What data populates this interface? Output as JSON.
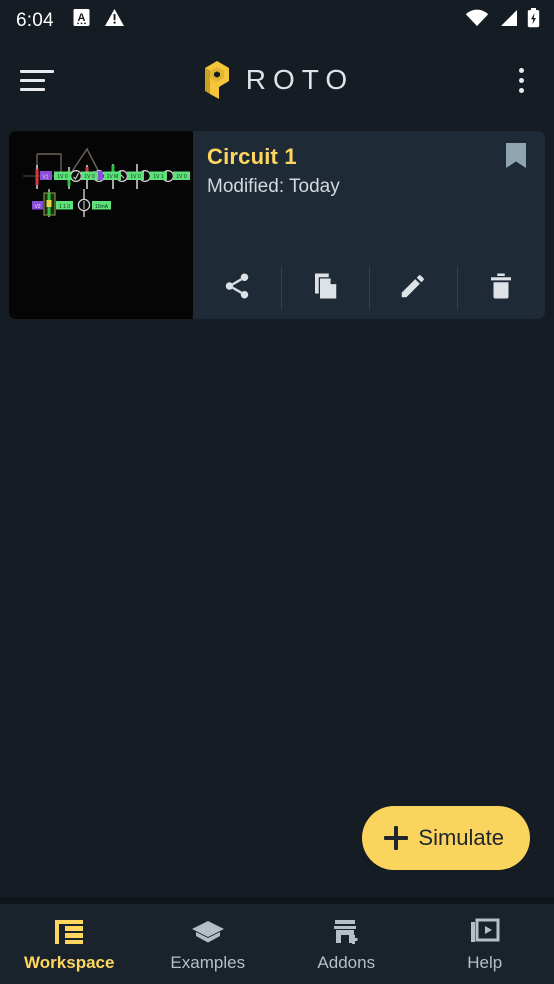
{
  "status_bar": {
    "time": "6:04",
    "left_icons": [
      "alphabet-mode-icon",
      "warning-triangle-icon"
    ],
    "right_icons": [
      "wifi-icon",
      "cellular-signal-icon",
      "battery-charging-icon"
    ]
  },
  "app_bar": {
    "menu_icon": "hamburger-menu-icon",
    "logo_icon": "proto-p-logo-icon",
    "title": "ROTO",
    "overflow_icon": "overflow-menu-icon",
    "logo_color": "#f5c63c",
    "title_color": "#dfe3e8"
  },
  "circuit_card": {
    "title": "Circuit 1",
    "subtitle": "Modified: Today",
    "bookmark_icon": "bookmark-icon",
    "thumbnail_name": "circuit-schematic-thumbnail",
    "title_color": "#ffd75e",
    "card_color": "#1e2a36",
    "actions": [
      {
        "name": "share-button",
        "icon": "share-icon"
      },
      {
        "name": "duplicate-button",
        "icon": "copy-icon"
      },
      {
        "name": "edit-button",
        "icon": "pencil-icon"
      },
      {
        "name": "delete-button",
        "icon": "trash-icon"
      }
    ]
  },
  "simulate_button": {
    "label": "Simulate",
    "icon": "plus-icon",
    "color": "#fbd45e"
  },
  "bottom_nav": {
    "items": [
      {
        "label": "Workspace",
        "icon": "workspace-layout-icon",
        "active": true
      },
      {
        "label": "Examples",
        "icon": "graduation-cap-icon",
        "active": false
      },
      {
        "label": "Addons",
        "icon": "store-add-icon",
        "active": false
      },
      {
        "label": "Help",
        "icon": "video-library-icon",
        "active": false
      }
    ],
    "active_color": "#ffd75e",
    "inactive_color": "#b6bfc7"
  },
  "theme": {
    "background": "#151c24",
    "nav_background": "#1a222b"
  }
}
